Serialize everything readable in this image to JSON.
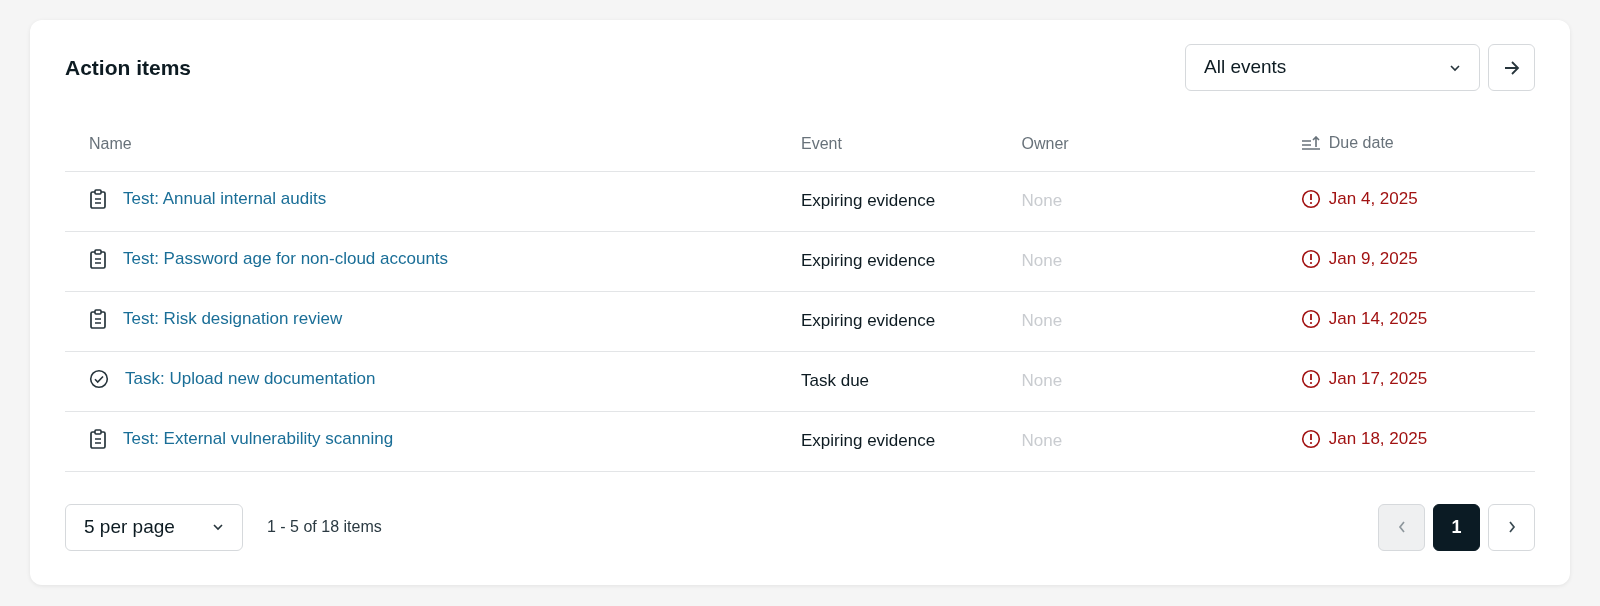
{
  "title": "Action items",
  "filter": {
    "value": "All events"
  },
  "columns": [
    {
      "label": "Name",
      "sorted": false
    },
    {
      "label": "Event",
      "sorted": false
    },
    {
      "label": "Owner",
      "sorted": false
    },
    {
      "label": "Due date",
      "sorted": true
    }
  ],
  "rows": [
    {
      "kind": "test",
      "name": "Test: Annual internal audits",
      "event": "Expiring evidence",
      "owner": "None",
      "owner_assigned": false,
      "due": "Jan 4, 2025",
      "overdue": true
    },
    {
      "kind": "test",
      "name": "Test: Password age for non-cloud accounts",
      "event": "Expiring evidence",
      "owner": "None",
      "owner_assigned": false,
      "due": "Jan 9, 2025",
      "overdue": true
    },
    {
      "kind": "test",
      "name": "Test: Risk designation review",
      "event": "Expiring evidence",
      "owner": "None",
      "owner_assigned": false,
      "due": "Jan 14, 2025",
      "overdue": true
    },
    {
      "kind": "task",
      "name": "Task: Upload new documentation",
      "event": "Task due",
      "owner": "None",
      "owner_assigned": false,
      "due": "Jan 17, 2025",
      "overdue": true
    },
    {
      "kind": "test",
      "name": "Test: External vulnerability scanning",
      "event": "Expiring evidence",
      "owner": "None",
      "owner_assigned": false,
      "due": "Jan 18, 2025",
      "overdue": true
    }
  ],
  "footer": {
    "page_size": "5 per page",
    "range": "1 - 5 of 18 items"
  },
  "pagination": {
    "prev_disabled": true,
    "next_disabled": false,
    "pages": [
      {
        "label": "1",
        "selected": true
      }
    ]
  }
}
